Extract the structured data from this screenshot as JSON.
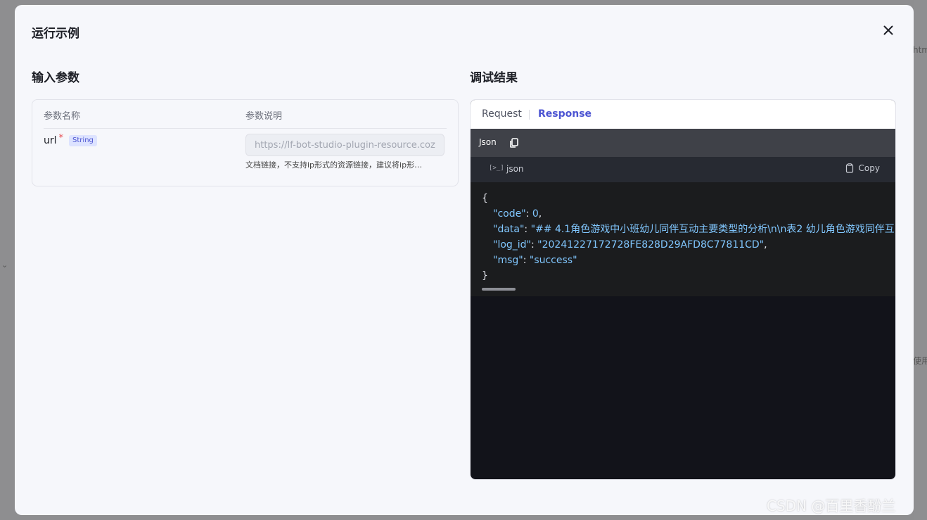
{
  "background": {
    "right_text_top": "htm",
    "right_text_bottom": "使用",
    "left_chevron": "⌄"
  },
  "modal": {
    "title": "运行示例",
    "close_icon": "close-icon"
  },
  "input_section": {
    "title": "输入参数",
    "columns": [
      "参数名称",
      "参数说明"
    ],
    "params": [
      {
        "name": "url",
        "required_mark": "*",
        "type": "String",
        "placeholder": "https://lf-bot-studio-plugin-resource.coze.cn",
        "description": "文档链接，不支持ip形式的资源链接，建议将ip形…"
      }
    ]
  },
  "result_section": {
    "title": "调试结果",
    "tabs": [
      {
        "label": "Request",
        "active": false
      },
      {
        "label": "Response",
        "active": true
      }
    ],
    "format_label": "Json",
    "code_lang": "json",
    "code_lang_icon": "[>_]",
    "copy_label": "Copy",
    "json": {
      "open": "{",
      "close": "}",
      "fields": [
        {
          "key": "\"code\"",
          "value": "0",
          "trail": ","
        },
        {
          "key": "\"data\"",
          "value": "\"## 4.1角色游戏中小班幼儿同伴互动主要类型的分析\\n\\n表2 幼儿角色游戏同伴互",
          "trail": ""
        },
        {
          "key": "\"log_id\"",
          "value": "\"20241227172728FE828D29AFD8C77811CD\"",
          "trail": ","
        },
        {
          "key": "\"msg\"",
          "value": "\"success\"",
          "trail": ""
        }
      ]
    }
  },
  "colors": {
    "accent": "#4c54d2",
    "code_string": "#81c7ff",
    "required": "#e5484d"
  },
  "watermark": "CSDN @百里香酚兰"
}
